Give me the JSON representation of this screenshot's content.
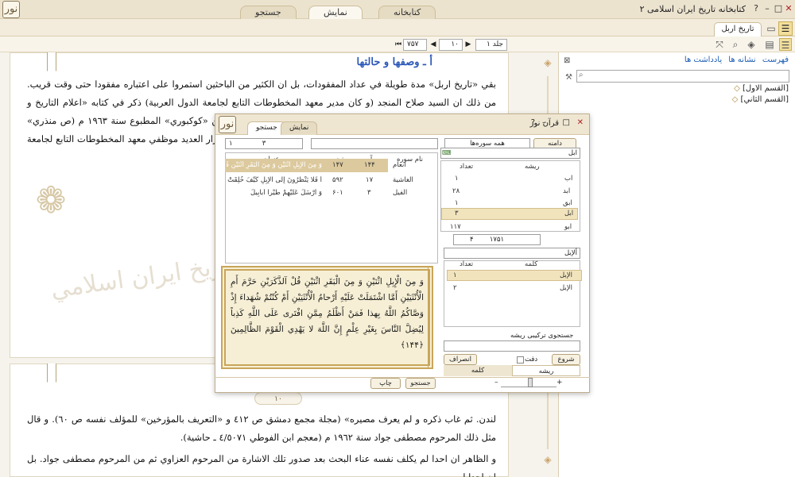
{
  "app": {
    "title": "کتابخانه تاریخ ایران اسلامی ۲",
    "logo": "نور",
    "tabs": [
      "کتابخانه",
      "نمایش",
      "جستجو"
    ],
    "active_tab": "نمایش"
  },
  "toolbar": {
    "right_tab": "تاریخ اربل"
  },
  "nav": {
    "volume": "جلد ۱",
    "page": "۱۰",
    "total": "۷۵۷"
  },
  "reader": {
    "heading": "أ ـ وصفها و حالتها",
    "para1": "بقي «تاريخ اربل» مدة طويلة في عداد المفقودات، بل ان الكثير من الباحثين استمروا على اعتباره مفقودا حتى وقت قريب. من ذلك ان السيد صلاح المنجد (و كان مدير معهد المخطوطات التابع لجامعة الدول العربية) ذكر في كتابه «اعلام التاريخ و الجغرافية العرب» ذلك الأستاذ فؤاد سيد في احدى حواشي «العقد تابه عن «كوكبوري» المطبوع سنة ١٩٦٣ م (ص منذري» المطبوع سنة ١٩٦٨ م بان «تاريخ ابن التي لها علاقة بالتراجم و الوفيات، و زار العديد موظفي معهد المخطوطات التابع لجامعة الدول نة ١٩٧٢ م، عند ما اطلعته على صور لمخطوطة",
    "para2": "تاريخ اربل لم يصل الينا منه الا ما علم اخيرا من",
    "watermark": "تاريخ ايران اسلامي",
    "page_number": "۱۰",
    "para3": "لندن. ثم غاب ذكره و لم يعرف مصيره» (مجلة مجمع دمشق ص ٤١٢ و «التعريف بالمؤرخين» للمؤلف نفسه ص ٦٠). و قال مثل ذلك المرحوم مصطفى جواد سنة ١٩٦٢ م (معجم ابن الفوطي ٤/٥٠٧١ ـ حاشية).",
    "para4": "و الظاهر ان احدا لم يكلف نفسه عناء البحث بعد صدور تلك الاشارة من المرحوم العزاوي ثم من المرحوم مصطفى جواد. بل ان احدا لم"
  },
  "right_panel": {
    "tabs": [
      "فهرست",
      "نشانه ها",
      "يادداشت ها"
    ],
    "tree": [
      "[القسم الاول]",
      "[القسم الثاني]"
    ]
  },
  "dialog": {
    "title": "قرآن نور",
    "tabs": [
      "جستجو",
      "نمایش"
    ],
    "scope_label": "دامنه",
    "scope_value": "همه سوره‌ها",
    "result_pages": "۳",
    "result_total": "۱",
    "columns": [
      "نام سوره",
      "آیه",
      "صفحه",
      "عنوان"
    ],
    "rows": [
      {
        "sura": "انعام",
        "aya": "۱۴۴",
        "page": "۱۴۷",
        "text": "وَ مِنَ الْإِبِلِ اثْنَيْنِ وَ مِنَ الْبَقَرِ اثْنَيْنِ قُلْ آلذَّكَرَيْنِ"
      },
      {
        "sura": "الغاشية",
        "aya": "۱۷",
        "page": "۵۹۲",
        "text": "أَ فَلا يَنْظُرُونَ إِلَى الْإِبِلِ كَيْفَ خُلِقَتْ"
      },
      {
        "sura": "الفيل",
        "aya": "۳",
        "page": "۶۰۱",
        "text": "وَ أَرْسَلَ عَلَيْهِمْ طَيْراً أَبابِيلَ"
      }
    ],
    "root_input": "ابل",
    "root_columns": [
      "ریشه",
      "تعداد"
    ],
    "roots": [
      {
        "root": "اب",
        "count": "۱"
      },
      {
        "root": "ابد",
        "count": "۲۸"
      },
      {
        "root": "ابق",
        "count": "۱"
      },
      {
        "root": "ابل",
        "count": "۳"
      },
      {
        "root": "ابو",
        "count": "۱۱۷"
      }
    ],
    "root_index": "۱۷۵۱",
    "root_total": "۴",
    "word_input": "ألإبل",
    "word_columns": [
      "کلمه",
      "تعداد"
    ],
    "words": [
      {
        "word": "الإبل",
        "count": "۱"
      },
      {
        "word": "الإبل",
        "count": "۲"
      }
    ],
    "combined_label": "جستجوی ترکیبی ریشه",
    "start_button": "شروع",
    "precise_label": "دقت",
    "cancel_button": "انصراف",
    "bottom_tabs": [
      "ریشه",
      "کلمه"
    ],
    "verse_text": "وَ مِنَ الْإِبِلِ اثْنَيْنِ وَ مِنَ الْبَقَرِ اثْنَيْنِ قُلْ آلذَّكَرَيْنِ حَرَّمَ أَمِ الْأُنْثَيَيْنِ أَمَّا اشْتَمَلَتْ عَلَيْهِ أَرْحامُ الْأُنْثَيَيْنِ أَمْ كُنْتُمْ شُهَداءَ إِذْ وَصَّاكُمُ اللَّهُ بِهذا فَمَنْ أَظْلَمُ مِمَّنِ افْتَرى عَلَى اللَّهِ كَذِباً لِيُضِلَّ النَّاسَ بِغَيْرِ عِلْمٍ إِنَّ اللَّهَ لا يَهْدِي الْقَوْمَ الظَّالِمِينَ ﴿۱۴۴﴾",
    "footer_buttons": [
      "جستجو",
      "چاپ"
    ]
  }
}
